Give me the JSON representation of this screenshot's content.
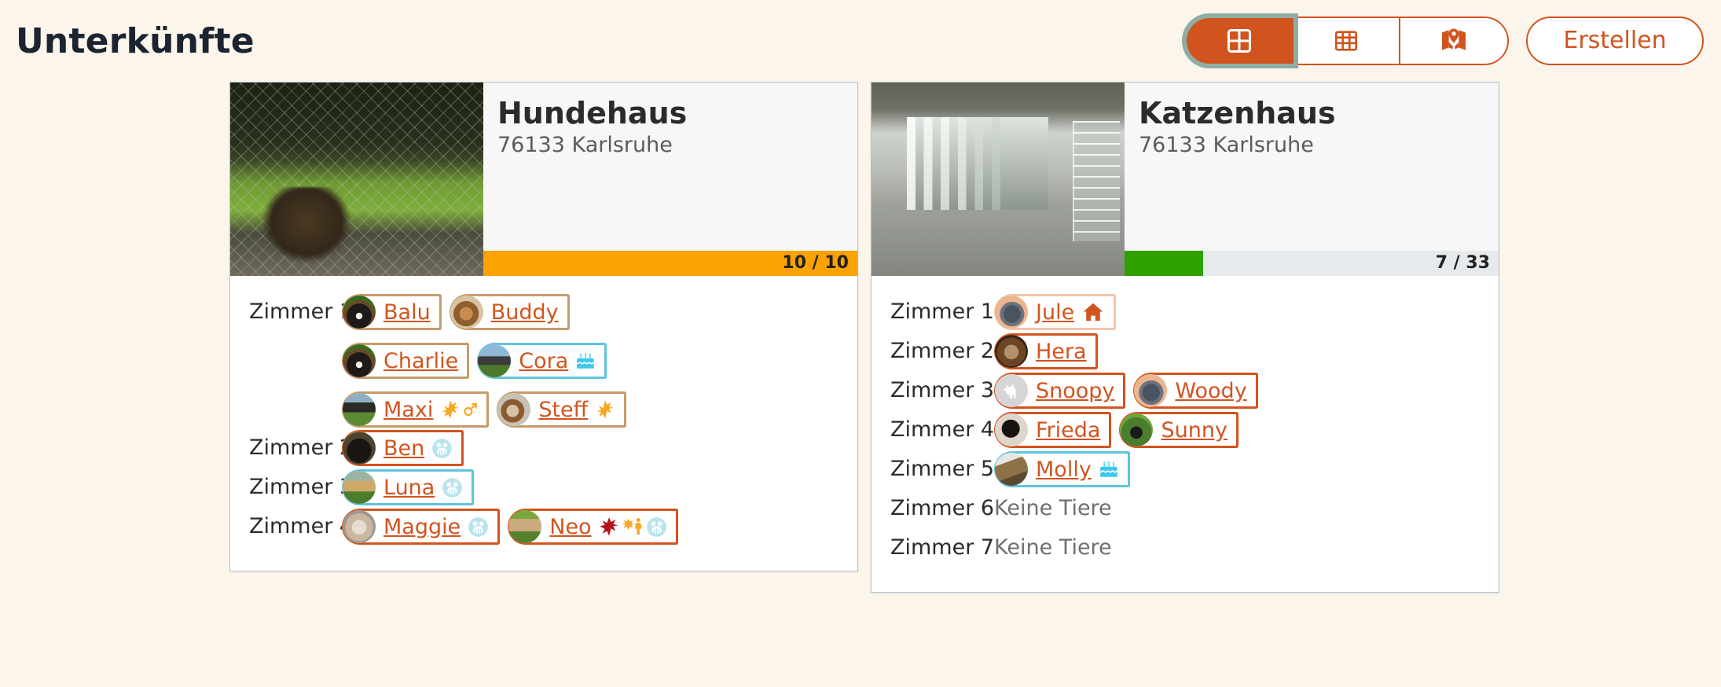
{
  "header": {
    "title": "Unterkünfte",
    "view_buttons": [
      {
        "name": "grid-view",
        "icon": "grid-large-icon",
        "active": true
      },
      {
        "name": "table-view",
        "icon": "grid-small-icon",
        "active": false
      },
      {
        "name": "map-view",
        "icon": "map-icon",
        "active": false
      }
    ],
    "create_label": "Erstellen"
  },
  "colors": {
    "accent": "#d1541f",
    "page_bg": "#fbf5ec",
    "progress_orange": "#f9a201",
    "progress_green": "#2ea000",
    "progress_track": "#e6eaed",
    "chip_tan": "#c79a6b",
    "chip_cyan": "#5fc4dd",
    "chip_peach": "#f3c4aa",
    "focus_ring": "#8fada4"
  },
  "cards": [
    {
      "title": "Hundehaus",
      "subtitle": "76133 Karlsruhe",
      "photo": "dog-kennel-photo",
      "occupancy_label": "10 / 10",
      "occupancy_percent": 100,
      "occupancy_color": "#f9a201",
      "rooms": [
        {
          "label": "Zimmer 1",
          "animals": [
            {
              "name": "Balu",
              "avatar": "av-berner",
              "border": "tan",
              "icons": []
            },
            {
              "name": "Buddy",
              "avatar": "av-buddy",
              "border": "tan",
              "icons": []
            },
            {
              "name": "Charlie",
              "avatar": "av-berner",
              "border": "tan",
              "icons": [],
              "newline": true
            },
            {
              "name": "Cora",
              "avatar": "av-cora",
              "border": "cyan",
              "icons": [
                "birthday-cake-icon"
              ]
            },
            {
              "name": "Maxi",
              "avatar": "av-maxi",
              "border": "tan",
              "icons": [
                "starburst-icon",
                "male-symbol-icon"
              ],
              "newline": true
            },
            {
              "name": "Steff",
              "avatar": "av-steff",
              "border": "tan",
              "icons": [
                "starburst-icon"
              ]
            }
          ]
        },
        {
          "label": "Zimmer 2",
          "animals": [
            {
              "name": "Ben",
              "avatar": "av-ben",
              "border": "orange",
              "icons": [
                "paw-badge-icon"
              ]
            }
          ]
        },
        {
          "label": "Zimmer 3",
          "animals": [
            {
              "name": "Luna",
              "avatar": "av-luna",
              "border": "cyan",
              "icons": [
                "paw-badge-icon"
              ]
            }
          ]
        },
        {
          "label": "Zimmer 4",
          "animals": [
            {
              "name": "Maggie",
              "avatar": "av-maggie",
              "border": "orange",
              "icons": [
                "paw-badge-icon"
              ]
            },
            {
              "name": "Neo",
              "avatar": "av-neo",
              "border": "orange",
              "icons": [
                "red-star-icon",
                "starburst-person-icon",
                "paw-badge-icon"
              ]
            }
          ]
        }
      ]
    },
    {
      "title": "Katzenhaus",
      "subtitle": "76133 Karlsruhe",
      "photo": "cat-room-photo",
      "occupancy_label": "7 / 33",
      "occupancy_percent": 21,
      "occupancy_color": "#2ea000",
      "rooms": [
        {
          "label": "Zimmer 1",
          "animals": [
            {
              "name": "Jule",
              "avatar": "av-jule",
              "border": "peach",
              "icons": [
                "home-icon"
              ]
            }
          ]
        },
        {
          "label": "Zimmer 2",
          "animals": [
            {
              "name": "Hera",
              "avatar": "av-hera",
              "border": "orange",
              "icons": []
            }
          ]
        },
        {
          "label": "Zimmer 3",
          "animals": [
            {
              "name": "Snoopy",
              "avatar": "av-snoopy",
              "border": "orange",
              "icons": [],
              "placeholder": "cat-silhouette-icon"
            },
            {
              "name": "Woody",
              "avatar": "av-woody",
              "border": "orange",
              "icons": []
            }
          ]
        },
        {
          "label": "Zimmer 4",
          "animals": [
            {
              "name": "Frieda",
              "avatar": "av-frieda",
              "border": "orange",
              "icons": []
            },
            {
              "name": "Sunny",
              "avatar": "av-sunny",
              "border": "orange",
              "icons": []
            }
          ]
        },
        {
          "label": "Zimmer 5",
          "animals": [
            {
              "name": "Molly",
              "avatar": "av-molly",
              "border": "cyan",
              "icons": [
                "birthday-cake-icon"
              ]
            }
          ]
        },
        {
          "label": "Zimmer 6",
          "animals": [],
          "empty_text": "Keine Tiere"
        },
        {
          "label": "Zimmer 7",
          "animals": [],
          "empty_text": "Keine Tiere"
        }
      ]
    }
  ]
}
